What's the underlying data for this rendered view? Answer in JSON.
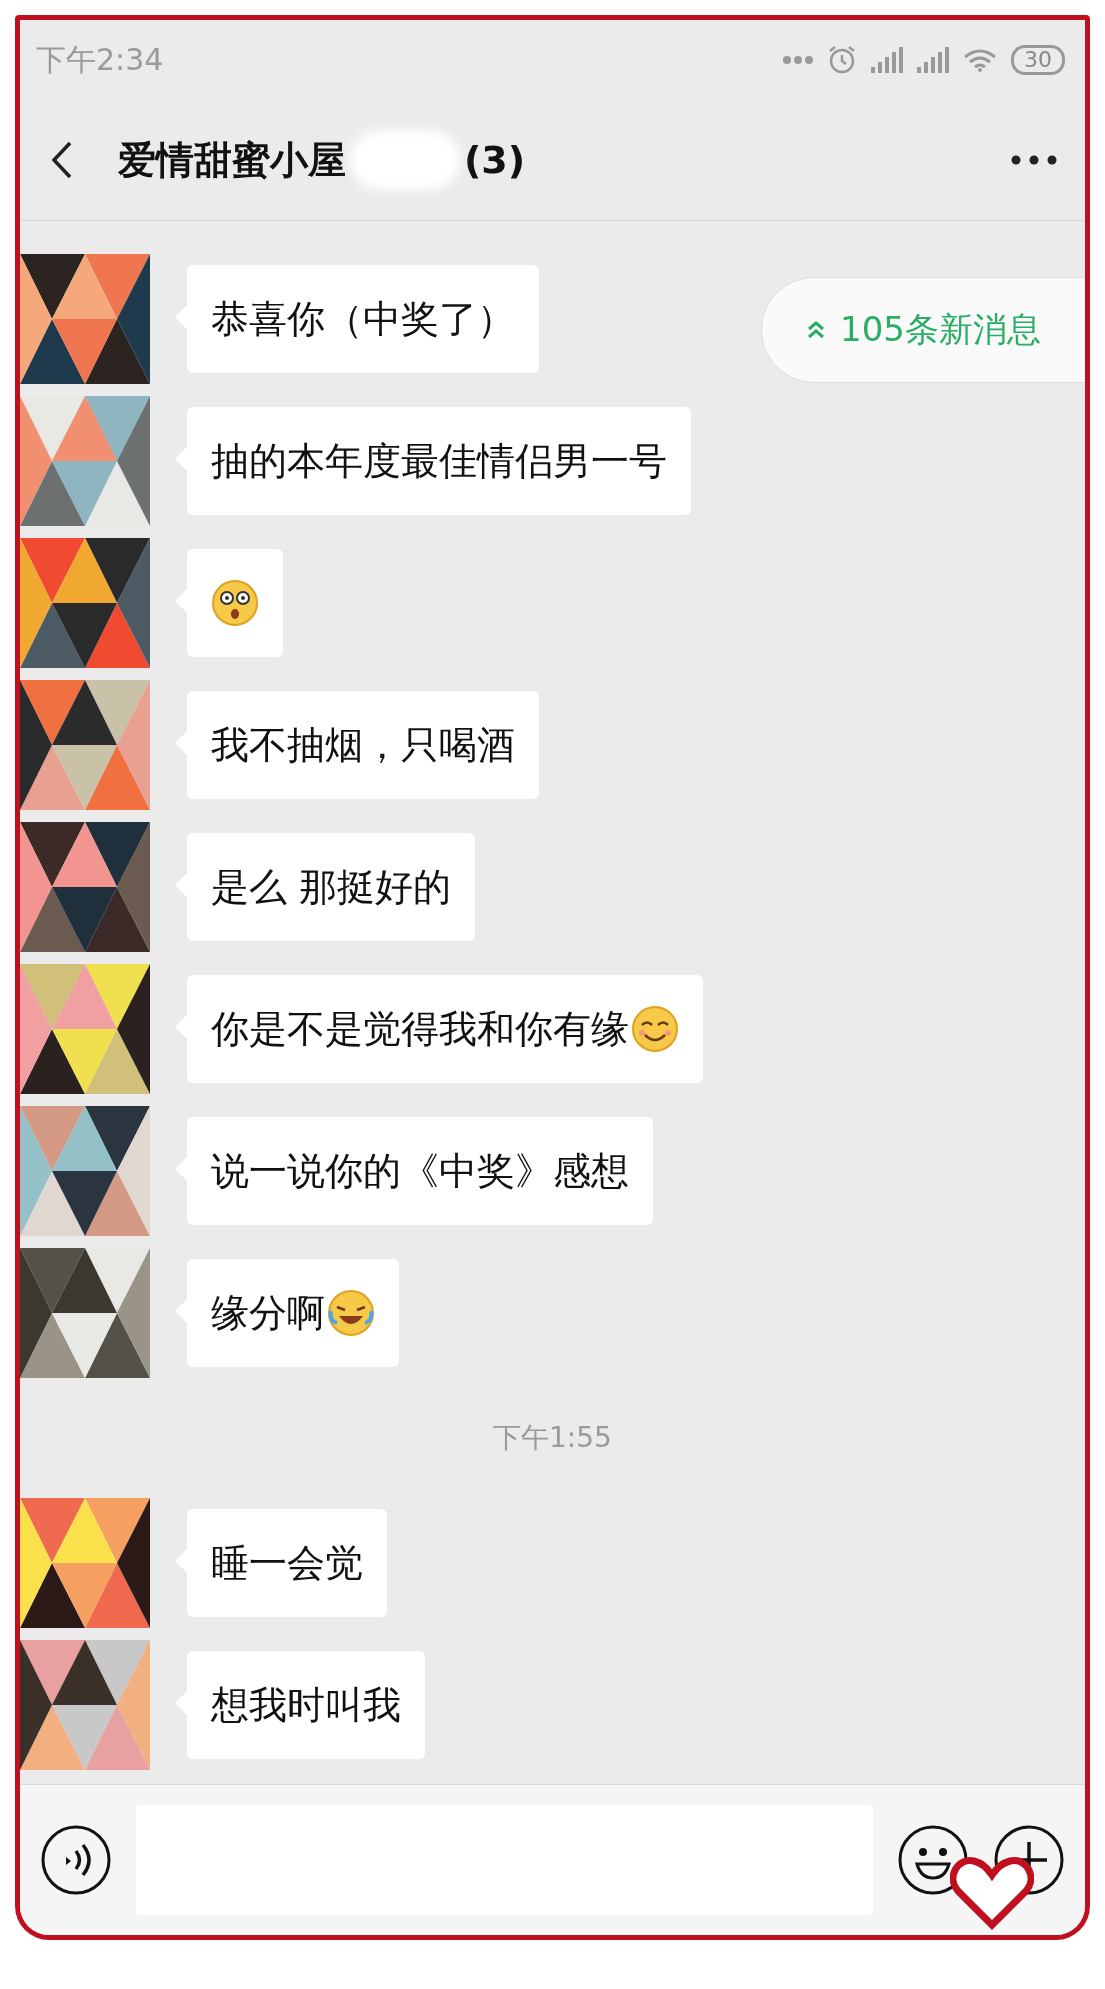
{
  "status_bar": {
    "time": "下午2:34",
    "battery": "30"
  },
  "header": {
    "title": "爱情甜蜜小屋",
    "count": "(3)"
  },
  "new_messages": {
    "label": "105条新消息"
  },
  "messages": [
    {
      "kind": "text",
      "text": "恭喜你（中奖了）"
    },
    {
      "kind": "text",
      "text": "抽的本年度最佳情侣男一号"
    },
    {
      "kind": "emoji",
      "emoji": {
        "kind": "shocked"
      }
    },
    {
      "kind": "text",
      "text": "我不抽烟，只喝酒"
    },
    {
      "kind": "text",
      "text": "是么 那挺好的"
    },
    {
      "kind": "text",
      "text": "你是不是觉得我和你有缘",
      "emoji": {
        "kind": "smile"
      }
    },
    {
      "kind": "text",
      "text": "说一说你的《中奖》感想"
    },
    {
      "kind": "text",
      "text": "缘分啊",
      "emoji": {
        "kind": "laugh-cry"
      }
    },
    {
      "kind": "time",
      "text": "下午1:55"
    },
    {
      "kind": "text",
      "text": "睡一会觉"
    },
    {
      "kind": "text",
      "text": "想我时叫我"
    }
  ]
}
